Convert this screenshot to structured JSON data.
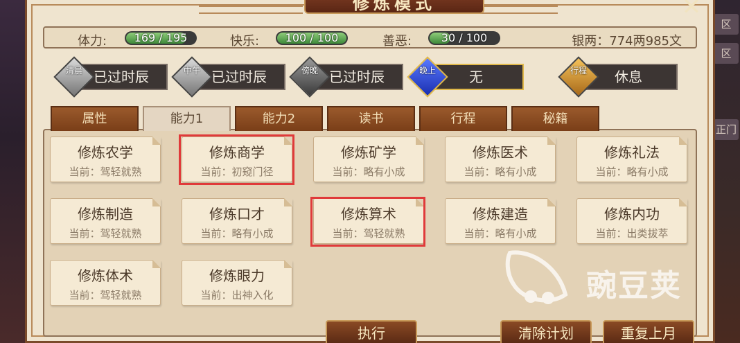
{
  "title": "修炼模式",
  "close_icon": "close-icon",
  "side_labels": [
    "区",
    "区",
    "正门"
  ],
  "stats": {
    "stamina": {
      "label": "体力:",
      "value": "169 / 195",
      "fraction": 0.867
    },
    "happiness": {
      "label": "快乐:",
      "value": "100 / 100",
      "fraction": 1.0
    },
    "morality": {
      "label": "善恶:",
      "value": "30 / 100",
      "fraction": 0.3
    },
    "money": "银两：774两985文"
  },
  "slots": [
    {
      "tag": "清晨",
      "text": "已过时辰",
      "color": "#cfcfcf"
    },
    {
      "tag": "中午",
      "text": "已过时辰",
      "color": "#bdbdbd"
    },
    {
      "tag": "傍晚",
      "text": "已过时辰",
      "color": "#8a8a8a"
    },
    {
      "tag": "晚上",
      "text": "无",
      "color": "#2d4fd8"
    },
    {
      "tag": "行程",
      "text": "休息",
      "color": "#e8a23a"
    }
  ],
  "tabs": [
    "属性",
    "能力1",
    "能力2",
    "读书",
    "行程",
    "秘籍"
  ],
  "active_tab": "能力1",
  "cards": [
    {
      "name": "修炼农学",
      "current": "当前：驾轻就熟"
    },
    {
      "name": "修炼商学",
      "current": "当前：初窥门径"
    },
    {
      "name": "修炼矿学",
      "current": "当前：略有小成"
    },
    {
      "name": "修炼医术",
      "current": "当前：略有小成"
    },
    {
      "name": "修炼礼法",
      "current": "当前：略有小成"
    },
    {
      "name": "修炼制造",
      "current": "当前：驾轻就熟"
    },
    {
      "name": "修炼口才",
      "current": "当前：略有小成"
    },
    {
      "name": "修炼算术",
      "current": "当前：驾轻就熟"
    },
    {
      "name": "修炼建造",
      "current": "当前：略有小成"
    },
    {
      "name": "修炼内功",
      "current": "当前：出类拔萃"
    },
    {
      "name": "修炼体术",
      "current": "当前：驾轻就熟"
    },
    {
      "name": "修炼眼力",
      "current": "当前：出神入化"
    }
  ],
  "buttons": {
    "execute": "执行",
    "clear": "清除计划",
    "repeat": "重复上月"
  },
  "watermark": "豌豆荚",
  "accent_color": "#e03a3a"
}
